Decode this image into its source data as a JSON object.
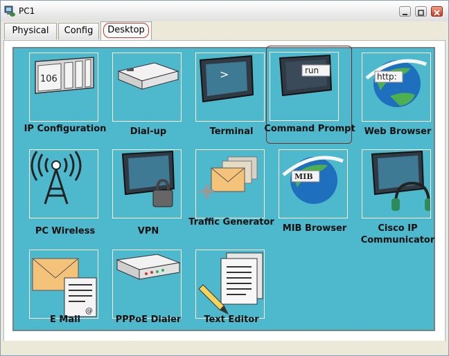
{
  "window": {
    "title": "PC1"
  },
  "tabs": [
    {
      "label": "Physical"
    },
    {
      "label": "Config"
    },
    {
      "label": "Desktop"
    }
  ],
  "apps": [
    {
      "label": "IP Configuration",
      "icon": "ip-config-icon"
    },
    {
      "label": "Dial-up",
      "icon": "modem-icon"
    },
    {
      "label": "Terminal",
      "icon": "terminal-icon",
      "screen_text": ">"
    },
    {
      "label": "Command Prompt",
      "icon": "command-prompt-icon",
      "screen_text": "run"
    },
    {
      "label": "Web Browser",
      "icon": "web-browser-icon",
      "badge_text": "http:"
    },
    {
      "label": "PC Wireless",
      "icon": "wireless-tower-icon"
    },
    {
      "label": "VPN",
      "icon": "vpn-lock-icon"
    },
    {
      "label": "Traffic Generator",
      "icon": "traffic-generator-icon"
    },
    {
      "label": "MIB Browser",
      "icon": "mib-browser-icon",
      "badge_text": "MIB"
    },
    {
      "label": "Cisco IP Communicator",
      "icon": "ip-communicator-icon"
    },
    {
      "label": "E Mail",
      "icon": "email-icon"
    },
    {
      "label": "PPPoE Dialer",
      "icon": "pppoe-dialer-icon"
    },
    {
      "label": "Text Editor",
      "icon": "text-editor-icon"
    }
  ],
  "ip_config_number": "106",
  "colors": {
    "desktop_bg": "#4eb9cc",
    "selected_border": "#7b2a2a",
    "close_button": "#c5371c"
  }
}
